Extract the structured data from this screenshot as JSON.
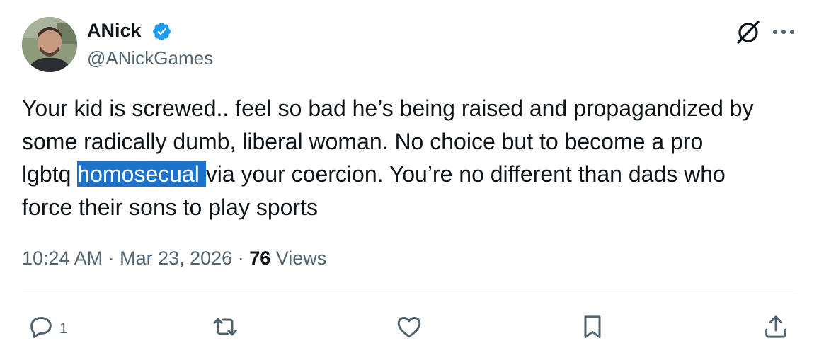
{
  "author": {
    "display_name": "ANick",
    "handle": "@ANickGames",
    "verified": true,
    "verified_color": "#1d9bf0"
  },
  "tweet": {
    "line1": "Your kid is screwed.. feel so bad he’s being raised and propagandized by",
    "line2": "some radically dumb, liberal woman. No choice but to become a pro",
    "line3_before": "lgbtq ",
    "line3_selected": "homosecual ",
    "line3_after": "via your coercion. You’re no different than dads who",
    "line4": "force their sons to play sports",
    "selection_color": "#1d73c9"
  },
  "meta": {
    "time": "10:24 AM",
    "separator": " · ",
    "date": "Mar 23, 2026",
    "views_count": "76",
    "views_label": " Views"
  },
  "actions": {
    "reply_icon": "reply-icon",
    "reply_count": "1",
    "retweet_icon": "retweet-icon",
    "like_icon": "heart-icon",
    "bookmark_icon": "bookmark-icon",
    "share_icon": "share-icon",
    "icon_color": "#536471"
  },
  "header_icons": {
    "grok": "grok-icon",
    "more": "more-icon"
  }
}
